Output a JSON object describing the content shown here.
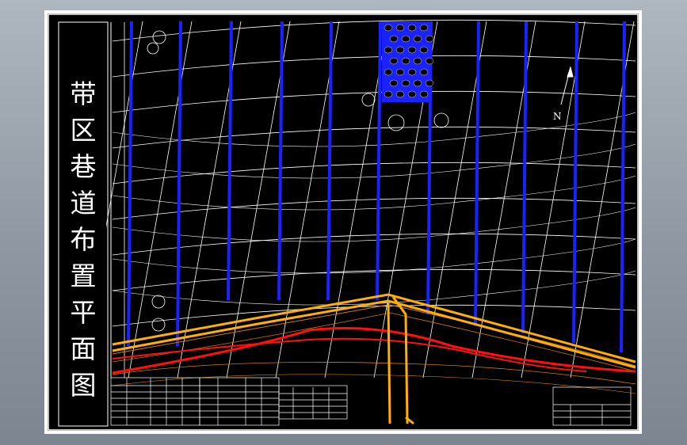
{
  "drawing": {
    "title_chars": [
      "带",
      "区",
      "巷",
      "道",
      "布",
      "置",
      "平",
      "面",
      "图"
    ],
    "north_label": "N"
  },
  "colors": {
    "background": "#000000",
    "roadway_blue": "#1a22ff",
    "conveyor_orange": "#ffb000",
    "boundary_red": "#ff1010",
    "contour_white": "#ffffff",
    "thin_orange": "#d07a10",
    "goaf_fill": "#1a22ff"
  }
}
